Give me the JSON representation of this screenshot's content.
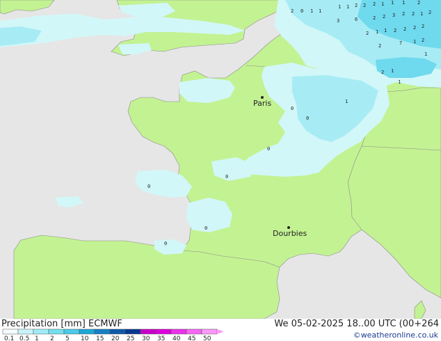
{
  "map": {
    "cities": [
      {
        "name": "Paris"
      },
      {
        "name": "Dourbies"
      }
    ],
    "precip_labels": [
      "2",
      "0",
      "1",
      "1",
      "1",
      "1",
      "2",
      "2",
      "2",
      "1",
      "1",
      "1",
      "2",
      "3",
      "6",
      "2",
      "2",
      "3",
      "2",
      "2",
      "1",
      "2",
      "2",
      "1",
      "1",
      "2",
      "2",
      "2",
      "2",
      "2",
      "7",
      "1",
      "2",
      "1",
      "2",
      "1",
      "1",
      "1",
      "0",
      "0",
      "0",
      "0",
      "0",
      "0",
      "0"
    ]
  },
  "footer": {
    "title": "Precipitation [mm]  ECMWF",
    "run": "We 05-02-2025 18..00 UTC (00+264",
    "credit": "©weatheronline.co.uk"
  },
  "legend": {
    "ticks": [
      "0.1",
      "0.5",
      "1",
      "2",
      "5",
      "10",
      "15",
      "20",
      "25",
      "30",
      "35",
      "40",
      "45",
      "50"
    ],
    "colors": [
      "#f5fcfe",
      "#c8f3fb",
      "#a0ebf6",
      "#72dfee",
      "#4cc8e8",
      "#1fa6d8",
      "#1580c4",
      "#0c5aa8",
      "#053892",
      "#c900c9",
      "#dc00dc",
      "#ea33ea",
      "#f566f5",
      "#fa99fa"
    ]
  },
  "colors": {
    "sea": "#e6e6e6",
    "land": "#c3f293",
    "precip_light": "#d2f7f9",
    "precip_mid": "#a7ecf4",
    "precip_heavy": "#6fd9ee"
  }
}
